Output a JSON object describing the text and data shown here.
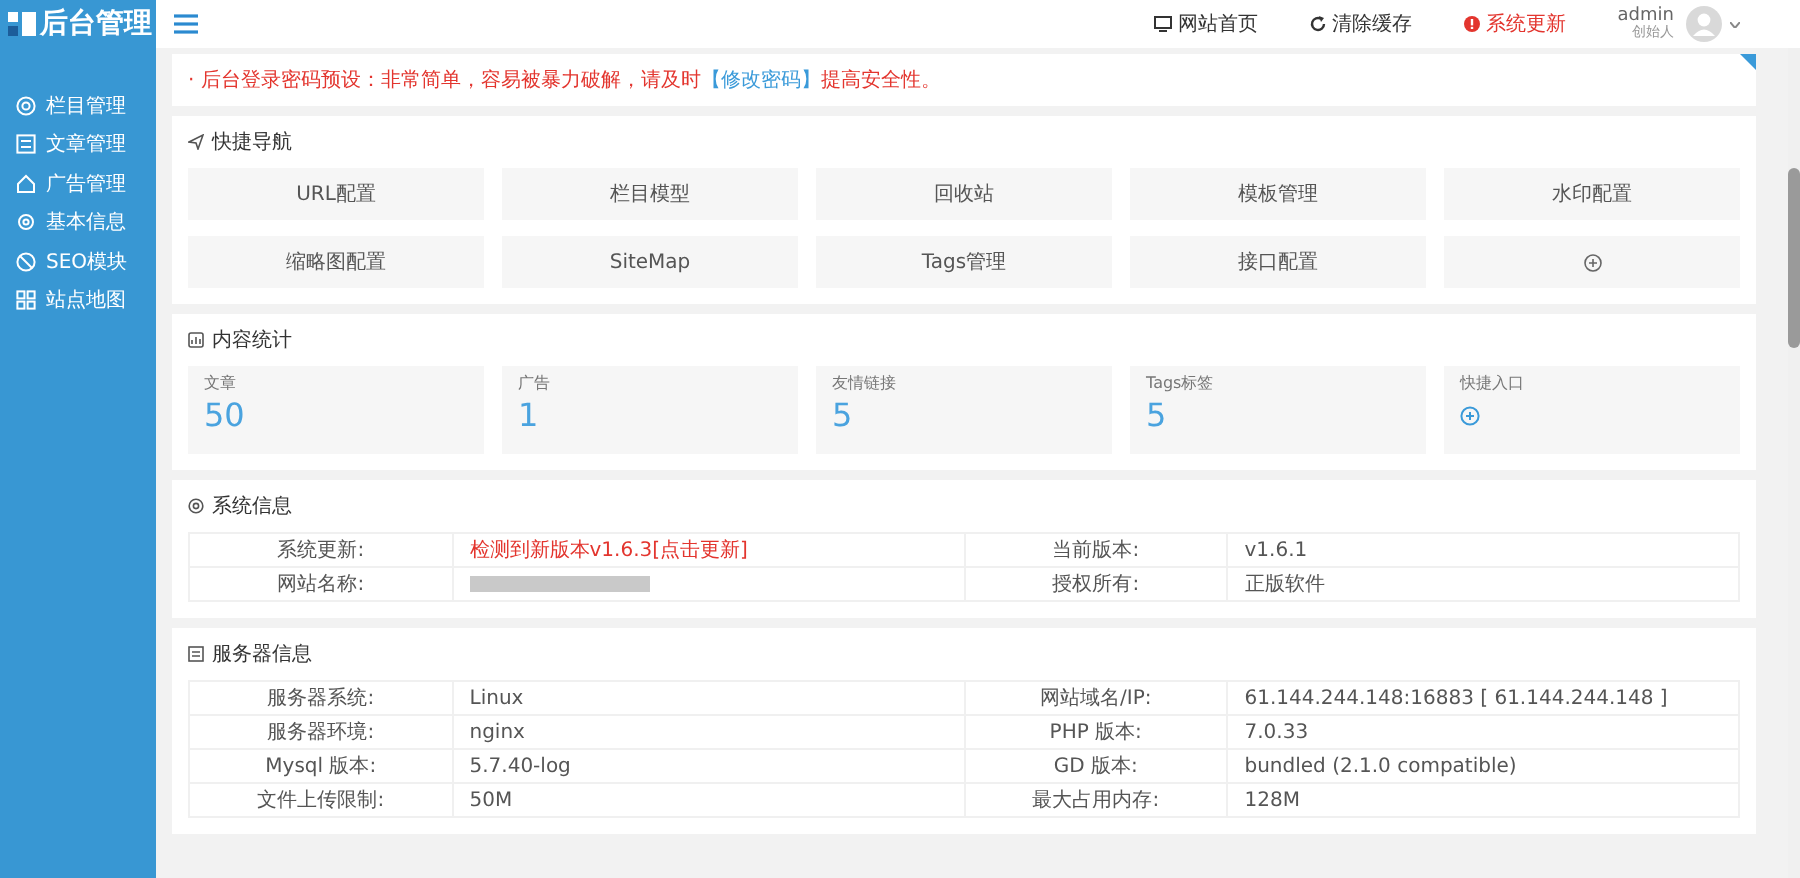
{
  "sidebar": {
    "logo": "后台管理",
    "items": [
      {
        "label": "栏目管理"
      },
      {
        "label": "文章管理"
      },
      {
        "label": "广告管理"
      },
      {
        "label": "基本信息"
      },
      {
        "label": "SEO模块"
      },
      {
        "label": "站点地图"
      }
    ]
  },
  "header": {
    "links": [
      {
        "label": "网站首页",
        "kind": "normal"
      },
      {
        "label": "清除缓存",
        "kind": "normal"
      },
      {
        "label": "系统更新",
        "kind": "warning"
      }
    ],
    "user": {
      "name": "admin",
      "role": "创始人"
    }
  },
  "alert": {
    "before": "· 后台登录密码预设：非常简单，容易被暴力破解，请及时",
    "link": "【修改密码】",
    "after": "提高安全性。"
  },
  "quick_nav": {
    "title": "快捷导航",
    "items": [
      {
        "label": "URL配置",
        "kind": "text"
      },
      {
        "label": "栏目模型",
        "kind": "text"
      },
      {
        "label": "回收站",
        "kind": "text"
      },
      {
        "label": "模板管理",
        "kind": "text"
      },
      {
        "label": "水印配置",
        "kind": "text"
      },
      {
        "label": "缩略图配置",
        "kind": "text"
      },
      {
        "label": "SiteMap",
        "kind": "text"
      },
      {
        "label": "Tags管理",
        "kind": "text"
      },
      {
        "label": "接口配置",
        "kind": "text"
      },
      {
        "kind": "add"
      }
    ]
  },
  "stats": {
    "title": "内容统计",
    "items": [
      {
        "label": "文章",
        "value": "50",
        "kind": "number"
      },
      {
        "label": "广告",
        "value": "1",
        "kind": "number"
      },
      {
        "label": "友情链接",
        "value": "5",
        "kind": "number"
      },
      {
        "label": "Tags标签",
        "value": "5",
        "kind": "number"
      },
      {
        "label": "快捷入口",
        "kind": "add"
      }
    ]
  },
  "system": {
    "title": "系统信息",
    "rows": [
      [
        {
          "label": "系统更新:",
          "value": "检测到新版本v1.6.3[点击更新]",
          "kind": "warning"
        },
        {
          "label": "当前版本:",
          "value": "v1.6.1",
          "kind": "text"
        }
      ],
      [
        {
          "label": "网站名称:",
          "kind": "redacted"
        },
        {
          "label": "授权所有:",
          "value": "正版软件",
          "kind": "text"
        }
      ]
    ]
  },
  "server": {
    "title": "服务器信息",
    "rows": [
      [
        {
          "label": "服务器系统:",
          "value": "Linux",
          "kind": "text"
        },
        {
          "label": "网站域名/IP:",
          "value": "61.144.244.148:16883 [ 61.144.244.148 ]",
          "kind": "text"
        }
      ],
      [
        {
          "label": "服务器环境:",
          "value": "nginx",
          "kind": "text"
        },
        {
          "label": "PHP 版本:",
          "value": "7.0.33",
          "kind": "text"
        }
      ],
      [
        {
          "label": "Mysql 版本:",
          "value": "5.7.40-log",
          "kind": "text"
        },
        {
          "label": "GD 版本:",
          "value": "bundled (2.1.0 compatible)",
          "kind": "text"
        }
      ],
      [
        {
          "label": "文件上传限制:",
          "value": "50M",
          "kind": "text"
        },
        {
          "label": "最大占用内存:",
          "value": "128M",
          "kind": "text"
        }
      ]
    ]
  }
}
